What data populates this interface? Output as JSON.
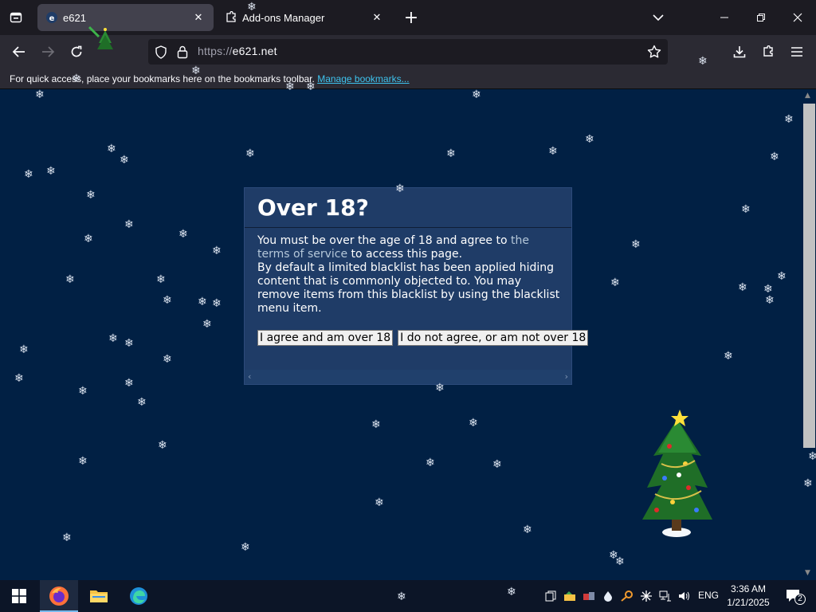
{
  "browser": {
    "tabs": [
      {
        "title": "e621",
        "active": true,
        "icon": "e621-favicon"
      },
      {
        "title": "Add-ons Manager",
        "active": false,
        "icon": "puzzle-icon"
      }
    ],
    "url": {
      "scheme": "https://",
      "host": "e621.net"
    },
    "bookmarks_bar": {
      "message": "For quick access, place your bookmarks here on the bookmarks toolbar.",
      "link": "Manage bookmarks..."
    }
  },
  "dialog": {
    "title": "Over 18?",
    "text_before_link": "You must be over the age of 18 and agree to ",
    "link_text": "the terms of service",
    "text_after_link": " to access this page.",
    "paragraph2": "By default a limited blacklist has been applied hiding content that is commonly objected to. You may remove items from this blacklist by using the blacklist menu item.",
    "agree_button": "I agree and am over 18",
    "disagree_button": "I do not agree, or am not over 18"
  },
  "taskbar": {
    "apps": [
      "windows-start",
      "firefox",
      "file-explorer",
      "edge"
    ],
    "language": "ENG",
    "time": "3:36 AM",
    "date": "1/21/2025",
    "notifications_count": "2"
  },
  "colors": {
    "page_bg": "#012044",
    "dialog_bg": "#1f3c67",
    "link": "#b4c7d9",
    "chrome_dark": "#1c1b22",
    "chrome": "#2b2a33",
    "bookmark_link": "#3ec3ee"
  },
  "decorations": {
    "snowflake_glyph": "❄",
    "tree": "christmas-tree-image"
  }
}
